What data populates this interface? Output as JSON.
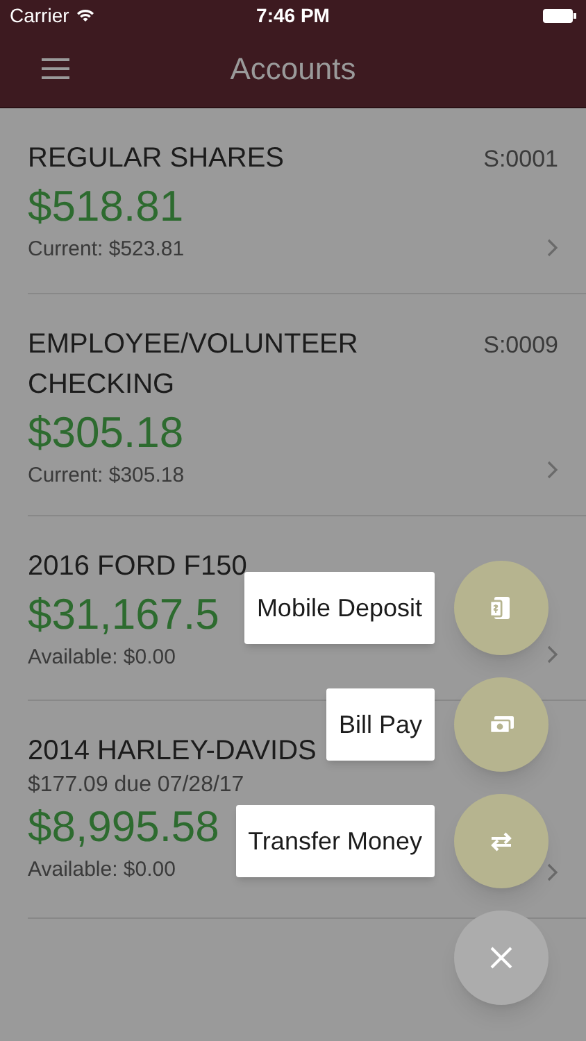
{
  "status_bar": {
    "carrier": "Carrier",
    "time": "7:46 PM"
  },
  "header": {
    "title": "Accounts"
  },
  "accounts": [
    {
      "name": "REGULAR SHARES",
      "number": "S:0001",
      "amount": "$518.81",
      "detail": "Current: $523.81"
    },
    {
      "name": "EMPLOYEE/VOLUNTEER CHECKING",
      "number": "S:0009",
      "amount": "$305.18",
      "detail": "Current: $305.18"
    },
    {
      "name": "2016 FORD F150",
      "amount": "$31,167.5",
      "detail": "Available: $0.00"
    },
    {
      "name": "2014 HARLEY-DAVIDS",
      "due": "$177.09 due 07/28/17",
      "amount": "$8,995.58",
      "detail": "Available: $0.00"
    }
  ],
  "actions": [
    {
      "label": "Mobile Deposit",
      "kind": "deposit"
    },
    {
      "label": "Bill Pay",
      "kind": "bill"
    },
    {
      "label": "Transfer Money",
      "kind": "transfer"
    }
  ]
}
